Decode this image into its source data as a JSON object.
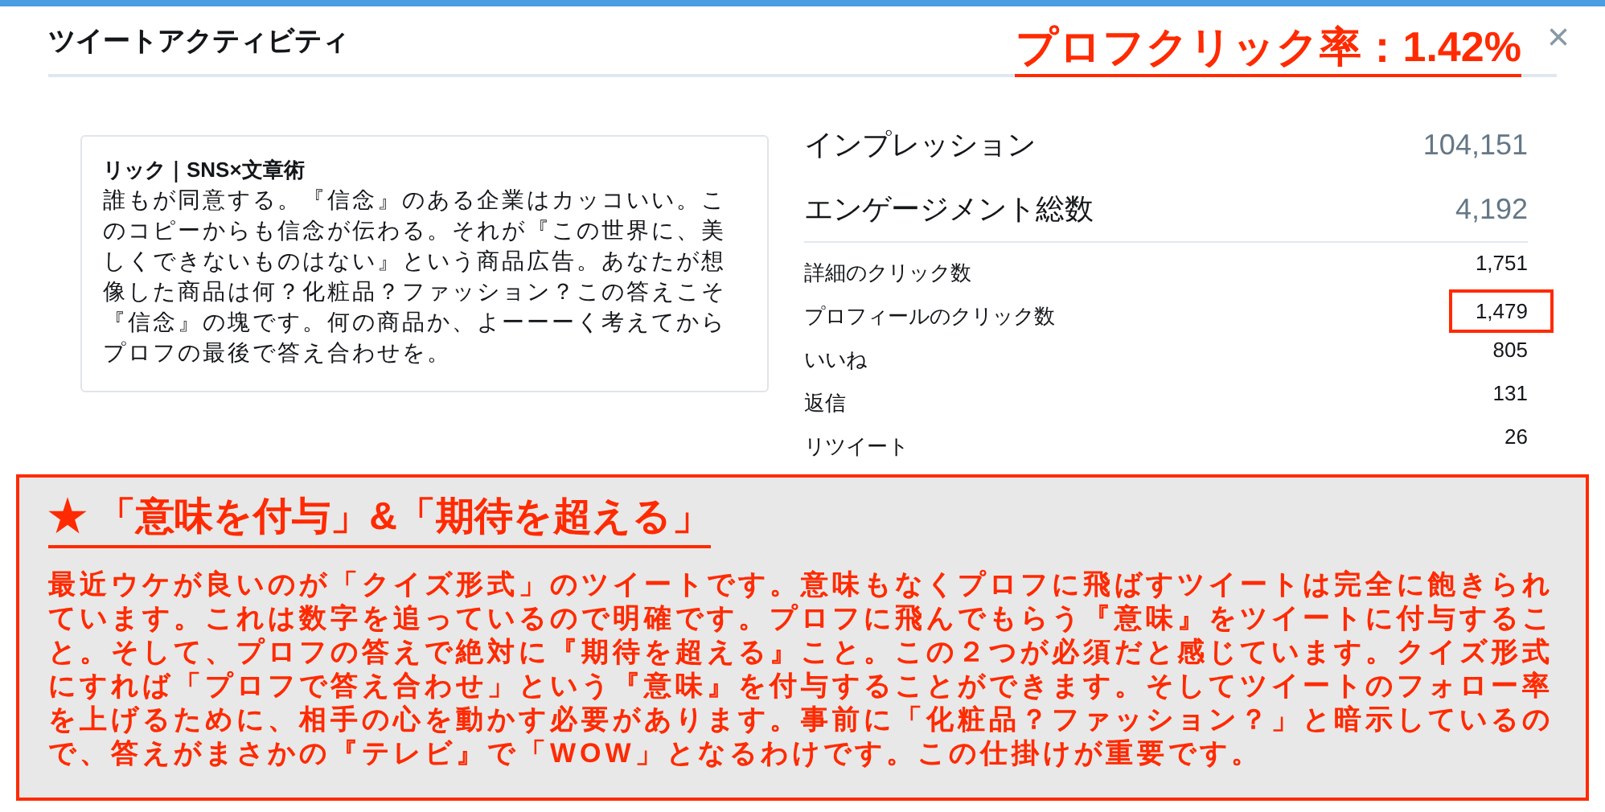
{
  "header": {
    "title": "ツイートアクティビティ",
    "annotation": "プロフクリック率：1.42%",
    "close": "×"
  },
  "tweet": {
    "author": "リック｜SNS×文章術",
    "text": "誰もが同意する。『信念』のある企業はカッコいい。このコピーからも信念が伝わる。それが『この世界に、美しくできないものはない』という商品広告。あなたが想像した商品は何？化粧品？ファッション？この答えこそ『信念』の塊です。何の商品か、よーーーく考えてからプロフの最後で答え合わせを。"
  },
  "summary": [
    {
      "label": "インプレッション",
      "value": "104,151"
    },
    {
      "label": "エンゲージメント総数",
      "value": "4,192"
    }
  ],
  "metrics": [
    {
      "label": "詳細のクリック数",
      "value": "1,751",
      "highlighted": false
    },
    {
      "label": "プロフィールのクリック数",
      "value": "1,479",
      "highlighted": true
    },
    {
      "label": "いいね",
      "value": "805",
      "highlighted": false
    },
    {
      "label": "返信",
      "value": "131",
      "highlighted": false
    },
    {
      "label": "リツイート",
      "value": "26",
      "highlighted": false
    }
  ],
  "note": {
    "heading": "★ 「意味を付与」&「期待を超える」",
    "body": "最近ウケが良いのが「クイズ形式」のツイートです。意味もなくプロフに飛ばすツイートは完全に飽きられています。これは数字を追っているので明確です。プロフに飛んでもらう『意味』をツイートに付与すること。そして、プロフの答えで絶対に『期待を超える』こと。この２つが必須だと感じています。クイズ形式にすれば「プロフで答え合わせ」という『意味』を付与することができます。そしてツイートのフォロー率を上げるために、相手の心を動かす必要があります。事前に「化粧品？ファッション？」と暗示しているので、答えがまさかの『テレビ』で「WOW」となるわけです。この仕掛けが重要です。"
  }
}
